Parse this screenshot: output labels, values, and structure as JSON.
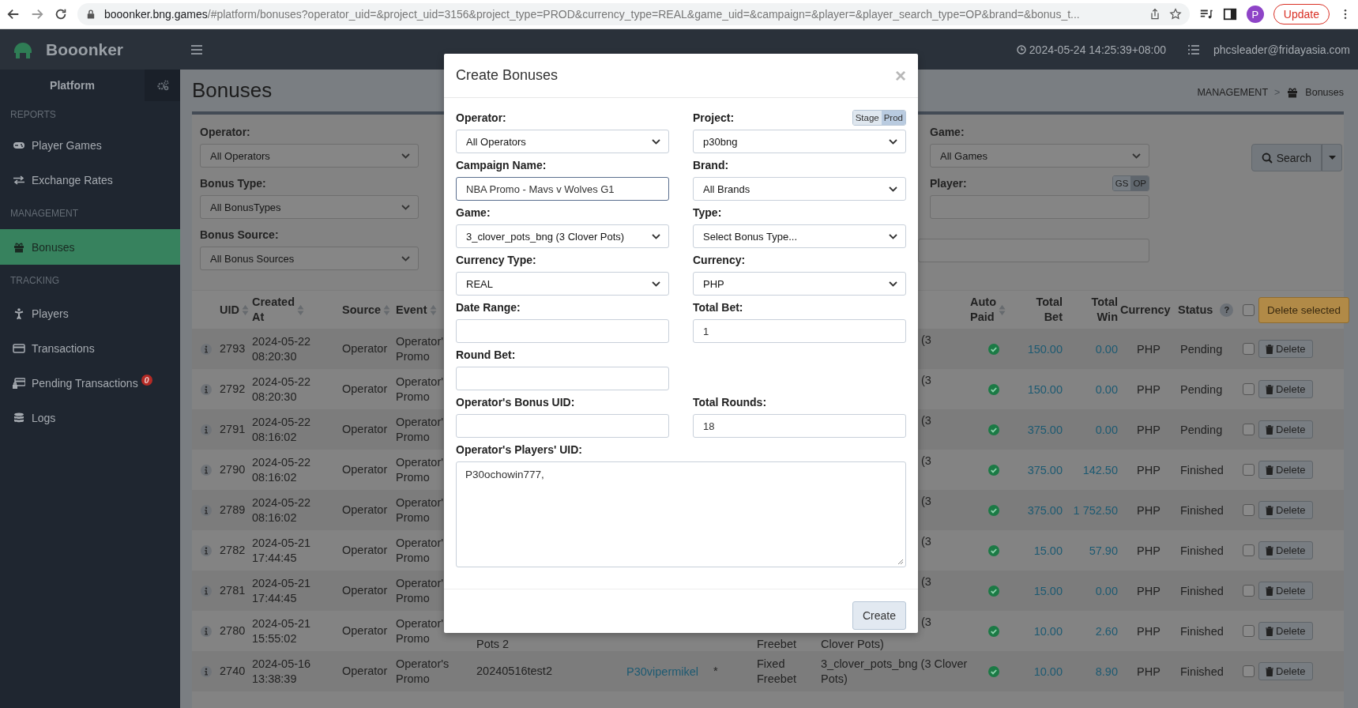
{
  "browser": {
    "host": "booonker.bng.games",
    "path": "/#platform/bonuses?operator_uid=&project_uid=3156&project_type=PROD&currency_type=REAL&game_uid=&campaign=&player=&player_search_type=OP&brand=&bonus_t...",
    "profile": "P",
    "update": "Update"
  },
  "header": {
    "brand": "Booonker",
    "datetime": "2024-05-24 14:25:39+08:00",
    "user": "phcsleader@fridayasia.com"
  },
  "sidebar": {
    "title": "Platform",
    "sections": [
      {
        "heading": "REPORTS",
        "items": [
          {
            "label": "Player Games",
            "kind": "gamepad",
            "selected": false
          },
          {
            "label": "Exchange Rates",
            "kind": "exchange",
            "selected": false
          }
        ]
      },
      {
        "heading": "MANAGEMENT",
        "items": [
          {
            "label": "Bonuses",
            "kind": "gift",
            "selected": true
          }
        ]
      },
      {
        "heading": "TRACKING",
        "items": [
          {
            "label": "Players",
            "kind": "person",
            "selected": false
          },
          {
            "label": "Transactions",
            "kind": "card",
            "selected": false
          },
          {
            "label": "Pending Transactions",
            "kind": "card-lock",
            "selected": false,
            "badge": "0"
          },
          {
            "label": "Logs",
            "kind": "database",
            "selected": false
          }
        ]
      }
    ]
  },
  "page": {
    "title": "Bonuses",
    "breadcrumb": [
      {
        "label": "MANAGEMENT"
      },
      {
        "label": "Bonuses",
        "kind": "gift"
      }
    ],
    "separator": ">"
  },
  "filters": {
    "left": [
      {
        "label": "Operator:",
        "kind": "select",
        "value": "All Operators"
      },
      {
        "label": "Bonus Type:",
        "kind": "select",
        "value": "All BonusTypes"
      },
      {
        "label": "Bonus Source:",
        "kind": "select",
        "value": "All Bonus Sources"
      }
    ],
    "right": [
      {
        "label": "Game:",
        "kind": "select",
        "value": "All Games"
      },
      {
        "label": "Player:",
        "kind": "input",
        "toggle": [
          {
            "label": "GS",
            "selected": false
          },
          {
            "label": "OP",
            "selected": true
          }
        ]
      },
      {
        "kind": "input"
      }
    ],
    "search": "Search"
  },
  "table": {
    "columns": [
      {
        "label": "UID",
        "sortable": true
      },
      {
        "label": "Created At",
        "sortable": true
      },
      {
        "label": "Source",
        "sortable": true
      },
      {
        "label": "Event",
        "sortable": true
      },
      {
        "label": "Auto Paid",
        "sortable": true
      },
      {
        "label": "Total Bet",
        "sortable": false
      },
      {
        "label": "Total Win",
        "sortable": false
      },
      {
        "label": "Currency",
        "sortable": false
      },
      {
        "label": "Status",
        "sortable": false,
        "help": "?"
      }
    ],
    "select_all": false,
    "delete_selected": "Delete selected",
    "rows": [
      {
        "uid": "2793",
        "created": "2024-05-22 08:20:30",
        "source": "Operator",
        "event": "Operator' Promo",
        "covered": true,
        "game": "(3",
        "auto_paid": true,
        "total_bet": "150.00",
        "total_win": "0.00",
        "currency": "PHP",
        "status": "Pending",
        "checked": false,
        "action": "Delete"
      },
      {
        "uid": "2792",
        "created": "2024-05-22 08:20:30",
        "source": "Operator",
        "event": "Operator' Promo",
        "covered": true,
        "game": "(3",
        "auto_paid": true,
        "total_bet": "150.00",
        "total_win": "0.00",
        "currency": "PHP",
        "status": "Pending",
        "checked": false,
        "action": "Delete"
      },
      {
        "uid": "2791",
        "created": "2024-05-22 08:16:02",
        "source": "Operator",
        "event": "Operator' Promo",
        "covered": true,
        "game": "(3",
        "auto_paid": true,
        "total_bet": "375.00",
        "total_win": "0.00",
        "currency": "PHP",
        "status": "Pending",
        "checked": false,
        "action": "Delete"
      },
      {
        "uid": "2790",
        "created": "2024-05-22 08:16:02",
        "source": "Operator",
        "event": "Operator' Promo",
        "covered": true,
        "game": "(3",
        "auto_paid": true,
        "total_bet": "375.00",
        "total_win": "142.50",
        "currency": "PHP",
        "status": "Finished",
        "checked": false,
        "action": "Delete"
      },
      {
        "uid": "2789",
        "created": "2024-05-22 08:16:02",
        "source": "Operator",
        "event": "Operator' Promo",
        "covered": true,
        "game": "(3",
        "auto_paid": true,
        "total_bet": "375.00",
        "total_win": "1 752.50",
        "currency": "PHP",
        "status": "Finished",
        "checked": false,
        "action": "Delete"
      },
      {
        "uid": "2782",
        "created": "2024-05-21 17:44:45",
        "source": "Operator",
        "event": "Operator' Promo",
        "covered": true,
        "game": "(3",
        "auto_paid": true,
        "total_bet": "15.00",
        "total_win": "57.90",
        "currency": "PHP",
        "status": "Finished",
        "checked": false,
        "action": "Delete"
      },
      {
        "uid": "2781",
        "created": "2024-05-21 17:44:45",
        "source": "Operator",
        "event": "Operator' Promo",
        "covered": true,
        "game": "(3",
        "auto_paid": true,
        "total_bet": "15.00",
        "total_win": "0.00",
        "currency": "PHP",
        "status": "Finished",
        "checked": false,
        "action": "Delete"
      },
      {
        "uid": "2780",
        "created": "2024-05-21 15:55:02",
        "source": "Operator",
        "event": "Operator' Promo",
        "covered": true,
        "game": "(3",
        "code_tail": "Pots 2",
        "type_tail": "Freebet",
        "game_tail": "Clover Pots)",
        "auto_paid": true,
        "total_bet": "10.00",
        "total_win": "2.60",
        "currency": "PHP",
        "status": "Finished",
        "checked": false,
        "action": "Delete"
      },
      {
        "uid": "2740",
        "created": "2024-05-16 13:38:39",
        "source": "Operator",
        "event": "Operator's Promo",
        "covered": false,
        "code": "20240516test2",
        "player": "P30vipermikel",
        "mark": "*",
        "type": "Fixed Freebet",
        "game": "3_clover_pots_bng (3 Clover Pots)",
        "auto_paid": true,
        "total_bet": "10.00",
        "total_win": "8.90",
        "currency": "PHP",
        "status": "Finished",
        "checked": false,
        "action": "Delete"
      }
    ]
  },
  "modal": {
    "title": "Create Bonuses",
    "close": "×",
    "rows": [
      [
        {
          "label": "Operator:",
          "kind": "select",
          "value": "All Operators"
        },
        {
          "label": "Project:",
          "kind": "select",
          "value": "p30bng",
          "toggle": [
            {
              "label": "Stage",
              "selected": false
            },
            {
              "label": "Prod",
              "selected": true
            }
          ]
        }
      ],
      [
        {
          "label": "Campaign Name:",
          "kind": "input",
          "value": "NBA Promo - Mavs v Wolves G1",
          "focused": true
        },
        {
          "label": "Brand:",
          "kind": "select",
          "value": "All Brands"
        }
      ],
      [
        {
          "label": "Game:",
          "kind": "select",
          "value": "3_clover_pots_bng (3 Clover Pots)"
        },
        {
          "label": "Type:",
          "kind": "select",
          "value": "Select Bonus Type..."
        }
      ],
      [
        {
          "label": "Currency Type:",
          "kind": "select",
          "value": "REAL"
        },
        {
          "label": "Currency:",
          "kind": "select",
          "value": "PHP"
        }
      ],
      [
        {
          "label": "Date Range:",
          "kind": "input"
        },
        {
          "label": "Total Bet:",
          "kind": "input",
          "value": "1"
        }
      ],
      [
        {
          "label": "Round Bet:",
          "kind": "input"
        }
      ],
      [
        {
          "label": "Operator's Bonus UID:",
          "kind": "input"
        },
        {
          "label": "Total Rounds:",
          "kind": "input",
          "value": "18"
        }
      ],
      [
        {
          "label": "Operator's Players' UID:",
          "kind": "textarea",
          "value": "P30ochowin777,"
        }
      ]
    ],
    "submit": "Create"
  }
}
